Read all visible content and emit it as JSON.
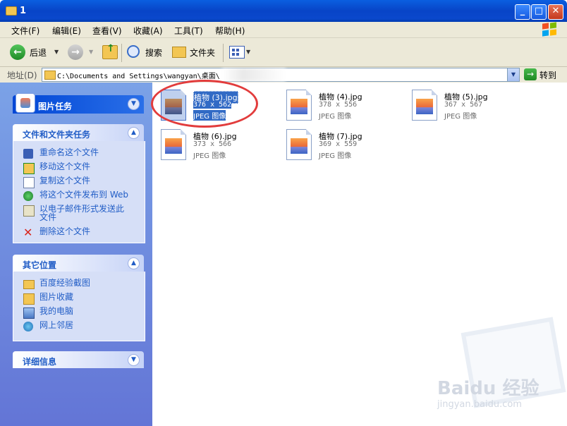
{
  "window": {
    "title": "1",
    "minimize": "_",
    "maximize": "□",
    "close": "✕"
  },
  "menu": [
    "文件(F)",
    "编辑(E)",
    "查看(V)",
    "收藏(A)",
    "工具(T)",
    "帮助(H)"
  ],
  "toolbar": {
    "back": "后退",
    "search": "搜索",
    "folders": "文件夹"
  },
  "address": {
    "label": "地址(D)",
    "path": "C:\\Documents and Settings\\wangyan\\桌面\\",
    "go": "转到"
  },
  "panels": {
    "picture_tasks": {
      "title": "图片任务"
    },
    "file_tasks": {
      "title": "文件和文件夹任务",
      "items": [
        "重命名这个文件",
        "移动这个文件",
        "复制这个文件",
        "将这个文件发布到 Web",
        "以电子邮件形式发送此文件",
        "删除这个文件"
      ]
    },
    "other_places": {
      "title": "其它位置",
      "items": [
        "百度经验截图",
        "图片收藏",
        "我的电脑",
        "网上邻居"
      ]
    },
    "details": {
      "title": "详细信息"
    }
  },
  "files": [
    {
      "name": "植物 (3).jpg",
      "dims": "376 x 562",
      "type": "JPEG 图像",
      "selected": true
    },
    {
      "name": "植物 (4).jpg",
      "dims": "378 x 556",
      "type": "JPEG 图像",
      "selected": false
    },
    {
      "name": "植物 (5).jpg",
      "dims": "367 x 567",
      "type": "JPEG 图像",
      "selected": false
    },
    {
      "name": "植物 (6).jpg",
      "dims": "373 x 566",
      "type": "JPEG 图像",
      "selected": false
    },
    {
      "name": "植物 (7).jpg",
      "dims": "369 x 559",
      "type": "JPEG 图像",
      "selected": false
    }
  ],
  "watermark": {
    "text": "Baidu 经验",
    "url": "jingyan.baidu.com"
  }
}
